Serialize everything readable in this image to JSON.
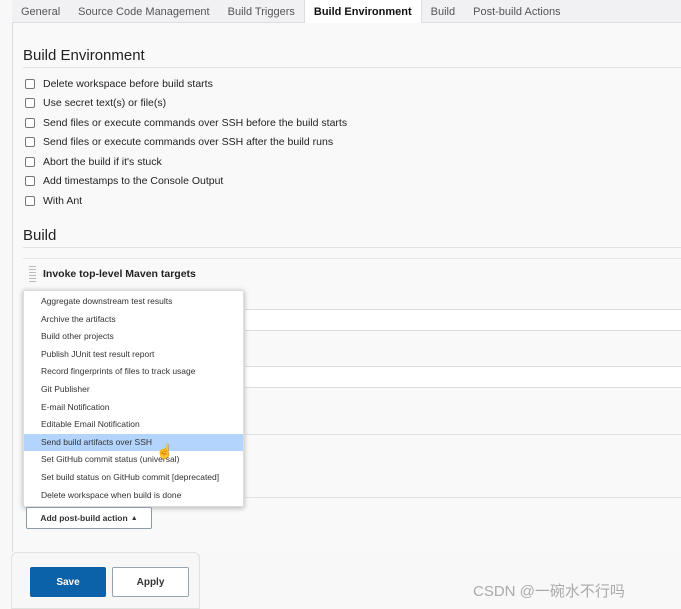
{
  "tabs": [
    "General",
    "Source Code Management",
    "Build Triggers",
    "Build Environment",
    "Build",
    "Post-build Actions"
  ],
  "active_tab": "Build Environment",
  "build_environment": {
    "title": "Build Environment",
    "options": [
      {
        "label": "Delete workspace before build starts",
        "checked": false
      },
      {
        "label": "Use secret text(s) or file(s)",
        "checked": false
      },
      {
        "label": "Send files or execute commands over SSH before the build starts",
        "checked": false
      },
      {
        "label": "Send files or execute commands over SSH after the build runs",
        "checked": false
      },
      {
        "label": "Abort the build if it's stuck",
        "checked": false
      },
      {
        "label": "Add timestamps to the Console Output",
        "checked": false
      },
      {
        "label": "With Ant",
        "checked": false
      }
    ]
  },
  "build": {
    "title": "Build",
    "step_title": "Invoke top-level Maven targets"
  },
  "post_build_menu": {
    "items": [
      "Aggregate downstream test results",
      "Archive the artifacts",
      "Build other projects",
      "Publish JUnit test result report",
      "Record fingerprints of files to track usage",
      "Git Publisher",
      "E-mail Notification",
      "Editable Email Notification",
      "Send build artifacts over SSH",
      "Set GitHub commit status (universal)",
      "Set build status on GitHub commit [deprecated]",
      "Delete workspace when build is done"
    ],
    "highlighted": "Send build artifacts over SSH"
  },
  "add_post_build_label": "Add post-build action",
  "footer": {
    "save": "Save",
    "apply": "Apply"
  },
  "watermark": "CSDN @一碗水不行吗",
  "colors": {
    "primary": "#0b62a8",
    "highlight": "#b3d4fc"
  }
}
